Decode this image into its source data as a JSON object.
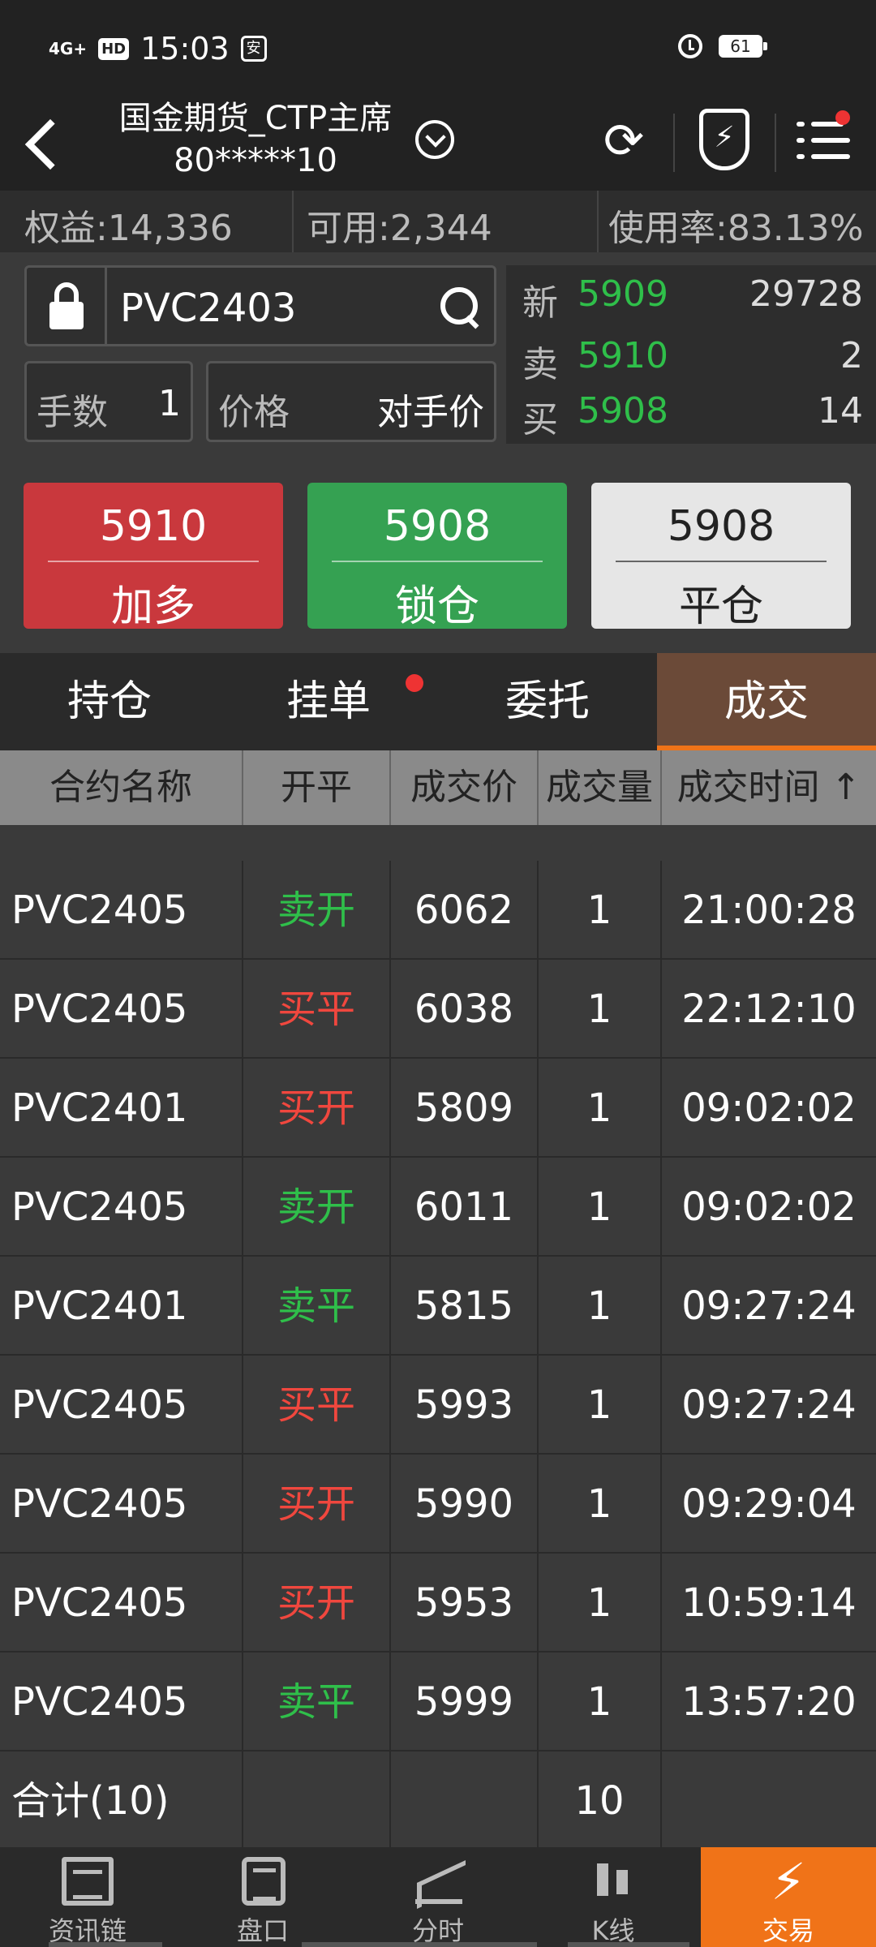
{
  "status_bar": {
    "signal": "4G+",
    "hd": "HD",
    "time": "15:03",
    "app_badge": "安",
    "battery": "61"
  },
  "header": {
    "account_line1": "国金期货_CTP主席",
    "account_line2": "80*****10",
    "icons": [
      "back-icon",
      "chevron-down-icon",
      "refresh-icon",
      "shield-bolt-icon",
      "menu-icon"
    ]
  },
  "summary": {
    "equity": "权益:14,336",
    "available": "可用:2,344",
    "usage": "使用率:83.13%"
  },
  "order": {
    "contract": "PVC2403",
    "qty_label": "手数",
    "qty_value": "1",
    "price_label": "价格",
    "price_value": "对手价"
  },
  "quote": {
    "last_label": "新",
    "last_price": "5909",
    "last_volume": "29728",
    "ask_label": "卖",
    "ask_price": "5910",
    "ask_volume": "2",
    "bid_label": "买",
    "bid_price": "5908",
    "bid_volume": "14"
  },
  "buttons": {
    "long": {
      "price": "5910",
      "label": "加多"
    },
    "lock": {
      "price": "5908",
      "label": "锁仓"
    },
    "close": {
      "price": "5908",
      "label": "平仓"
    }
  },
  "tabs": [
    "持仓",
    "挂单",
    "委托",
    "成交"
  ],
  "active_tab": 3,
  "table": {
    "headers": [
      "合约名称",
      "开平",
      "成交价",
      "成交量",
      "成交时间 ↑"
    ],
    "rows": [
      {
        "contract": "PVC2405",
        "action": "卖开",
        "price": "6062",
        "volume": "1",
        "time": "21:00:28",
        "color": "green"
      },
      {
        "contract": "PVC2405",
        "action": "买平",
        "price": "6038",
        "volume": "1",
        "time": "22:12:10",
        "color": "red"
      },
      {
        "contract": "PVC2401",
        "action": "买开",
        "price": "5809",
        "volume": "1",
        "time": "09:02:02",
        "color": "red"
      },
      {
        "contract": "PVC2405",
        "action": "卖开",
        "price": "6011",
        "volume": "1",
        "time": "09:02:02",
        "color": "green"
      },
      {
        "contract": "PVC2401",
        "action": "卖平",
        "price": "5815",
        "volume": "1",
        "time": "09:27:24",
        "color": "green"
      },
      {
        "contract": "PVC2405",
        "action": "买平",
        "price": "5993",
        "volume": "1",
        "time": "09:27:24",
        "color": "red"
      },
      {
        "contract": "PVC2405",
        "action": "买开",
        "price": "5990",
        "volume": "1",
        "time": "09:29:04",
        "color": "red"
      },
      {
        "contract": "PVC2405",
        "action": "买开",
        "price": "5953",
        "volume": "1",
        "time": "10:59:14",
        "color": "red"
      },
      {
        "contract": "PVC2405",
        "action": "卖平",
        "price": "5999",
        "volume": "1",
        "time": "13:57:20",
        "color": "green"
      }
    ],
    "total": {
      "label": "合计(10)",
      "volume": "10"
    }
  },
  "bottom_nav": [
    "资讯链",
    "盘口",
    "分时",
    "K线",
    "交易"
  ],
  "colors": {
    "buy": "#f0473e",
    "sell": "#2fbf4a",
    "accent": "#f07318"
  }
}
